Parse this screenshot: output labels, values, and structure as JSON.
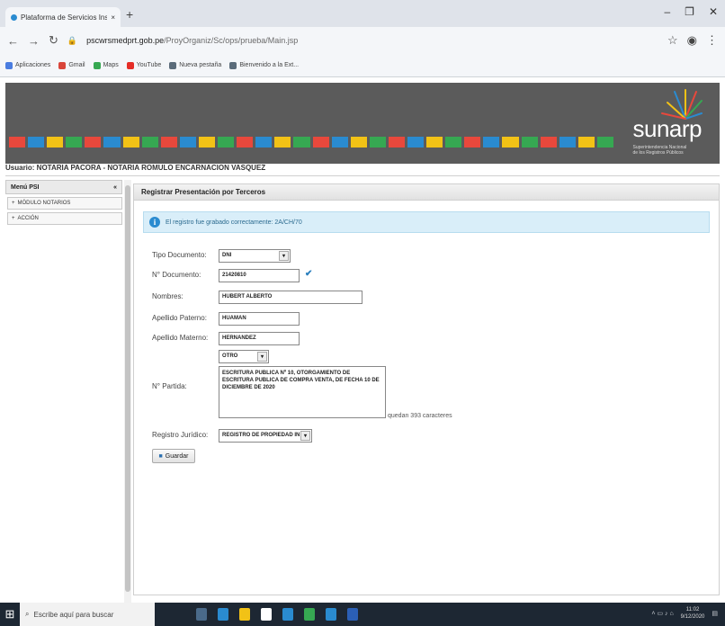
{
  "browser": {
    "tab_title": "Plataforma de Servicios Institucion...",
    "url_host": "pscwrsmedprt.gob.pe",
    "url_path": "/ProyOrganiz/Sc/ops/prueba/Main.jsp",
    "bookmarks": [
      "Aplicaciones",
      "Gmail",
      "Maps",
      "YouTube",
      "Nueva pestaña",
      "Bienvenido a la Ext..."
    ]
  },
  "site": {
    "brand_name": "sunarp",
    "brand_tagline": "Superintendencia Nacional de los Registros Públicos",
    "user_line": "Usuario: NOTARIA PACORA - NOTARIA ROMULO ENCARNACION VASQUEZ",
    "stripe_colors": [
      "#e8483c",
      "#2a8bd0",
      "#f2c216",
      "#36a852",
      "#e8483c",
      "#2a8bd0",
      "#f2c216",
      "#36a852",
      "#e8483c",
      "#2a8bd0",
      "#f2c216",
      "#36a852",
      "#e8483c",
      "#2a8bd0",
      "#f2c216",
      "#36a852",
      "#e8483c",
      "#2a8bd0",
      "#f2c216",
      "#36a852",
      "#e8483c",
      "#2a8bd0",
      "#f2c216",
      "#36a852",
      "#e8483c",
      "#2a8bd0",
      "#f2c216",
      "#36a852",
      "#e8483c",
      "#2a8bd0",
      "#f2c216",
      "#36a852"
    ]
  },
  "sidebar": {
    "header": "Menú PSI",
    "items": [
      "MÓDULO NOTARIOS",
      "ACCIÓN"
    ]
  },
  "form": {
    "panel_title": "Registrar Presentación por Terceros",
    "info_message": "El registro fue grabado correctamente: 2A/CH/70",
    "fields": {
      "tipo_documento": {
        "label": "Tipo Documento:",
        "value": "DNI"
      },
      "nro_documento": {
        "label": "N° Documento:",
        "value": "21420810"
      },
      "nombres": {
        "label": "Nombres:",
        "value": "HUBERT ALBERTO"
      },
      "apellido_paterno": {
        "label": "Apellido Paterno:",
        "value": "HUAMAN"
      },
      "apellido_materno": {
        "label": "Apellido Materno:",
        "value": "HERNANDEZ"
      },
      "partida": {
        "label": "N° Partida:",
        "select_value": "OTRO",
        "text": "ESCRITURA PUBLICA Nº 10, OTORGAMIENTO DE ESCRITURA PUBLICA DE COMPRA VENTA, DE FECHA 10 DE DICIEMBRE DE 2020",
        "remaining": "quedan 393 caracteres"
      },
      "registro_juridico": {
        "label": "Registro Jurídico:",
        "value": "REGISTRO DE PROPIEDAD IN"
      }
    },
    "save_label": "Guardar"
  },
  "taskbar": {
    "search_placeholder": "Escribe aquí para buscar",
    "clock_time": "11:02",
    "clock_date": "9/12/2020"
  }
}
